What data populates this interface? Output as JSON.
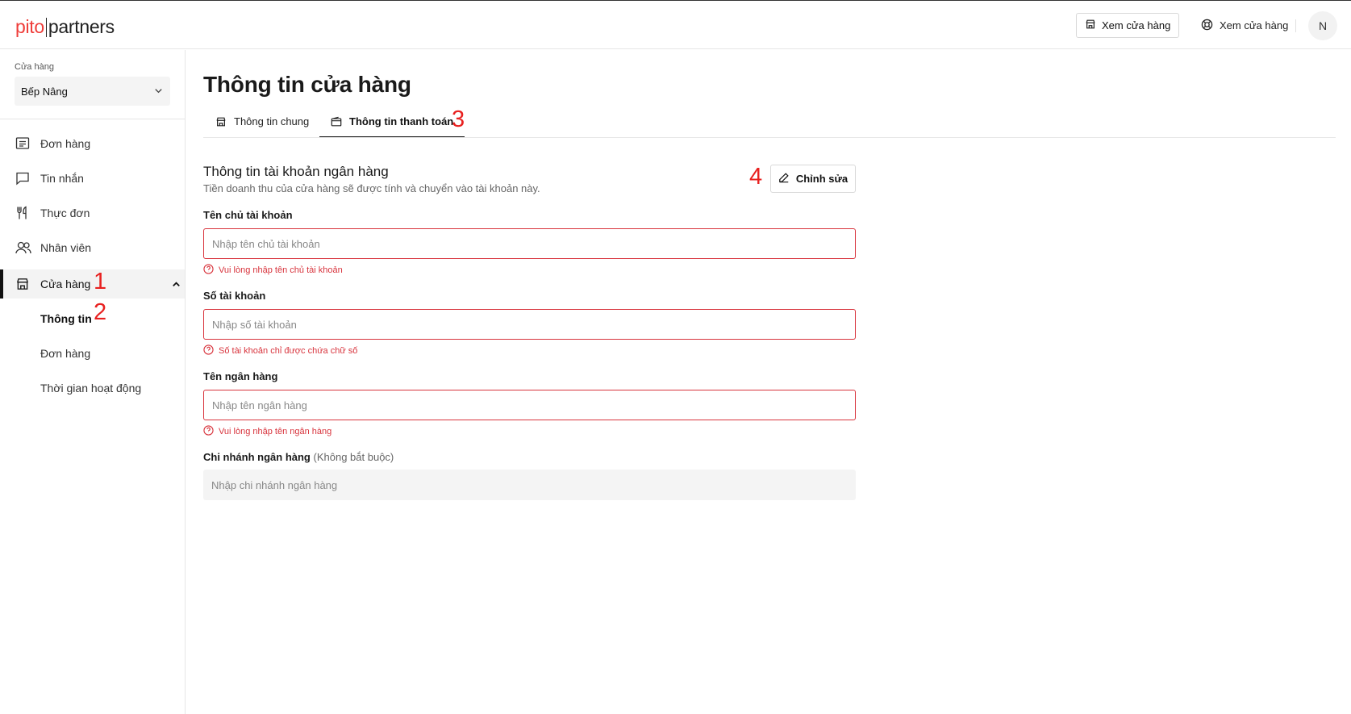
{
  "brand": {
    "left": "pito",
    "right": "partners"
  },
  "header": {
    "view_store_button": "Xem cửa hàng",
    "view_store_link": "Xem cửa hàng",
    "avatar_initial": "N"
  },
  "sidebar": {
    "store_label": "Cửa hàng",
    "store_selected": "Bếp Nâng",
    "items": [
      {
        "label": "Đơn hàng",
        "icon": "receipt-icon"
      },
      {
        "label": "Tin nhắn",
        "icon": "chat-icon"
      },
      {
        "label": "Thực đơn",
        "icon": "utensils-icon"
      },
      {
        "label": "Nhân viên",
        "icon": "users-icon"
      },
      {
        "label": "Cửa hàng",
        "icon": "store-icon"
      }
    ],
    "sub_items": [
      "Thông tin",
      "Đơn hàng",
      "Thời gian hoạt động"
    ]
  },
  "markers": {
    "m1": "1",
    "m2": "2",
    "m3": "3",
    "m4": "4"
  },
  "main": {
    "title": "Thông tin cửa hàng",
    "tabs": [
      {
        "label": "Thông tin chung",
        "icon": "store-icon"
      },
      {
        "label": "Thông tin thanh toán",
        "icon": "wallet-icon"
      }
    ],
    "section_title": "Thông tin tài khoản ngân hàng",
    "section_subtitle": "Tiền doanh thu của cửa hàng sẽ được tính và chuyển vào tài khoản này.",
    "edit_button": "Chỉnh sửa",
    "fields": {
      "owner": {
        "label": "Tên chủ tài khoản",
        "placeholder": "Nhập tên chủ tài khoản",
        "error": "Vui lòng nhập tên chủ tài khoản"
      },
      "account": {
        "label": "Số tài khoản",
        "placeholder": "Nhập số tài khoản",
        "error": "Số tài khoản chỉ được chứa chữ số"
      },
      "bank": {
        "label": "Tên ngân hàng",
        "placeholder": "Nhập tên ngân hàng",
        "error": "Vui lòng nhập tên ngân hàng"
      },
      "branch": {
        "label": "Chi nhánh ngân hàng",
        "optional": "(Không bắt buộc)",
        "placeholder": "Nhập chi nhánh ngân hàng"
      }
    }
  },
  "colors": {
    "brand_red": "#ef3d3a",
    "error_red": "#d8343d",
    "marker_red": "#e8201f"
  }
}
